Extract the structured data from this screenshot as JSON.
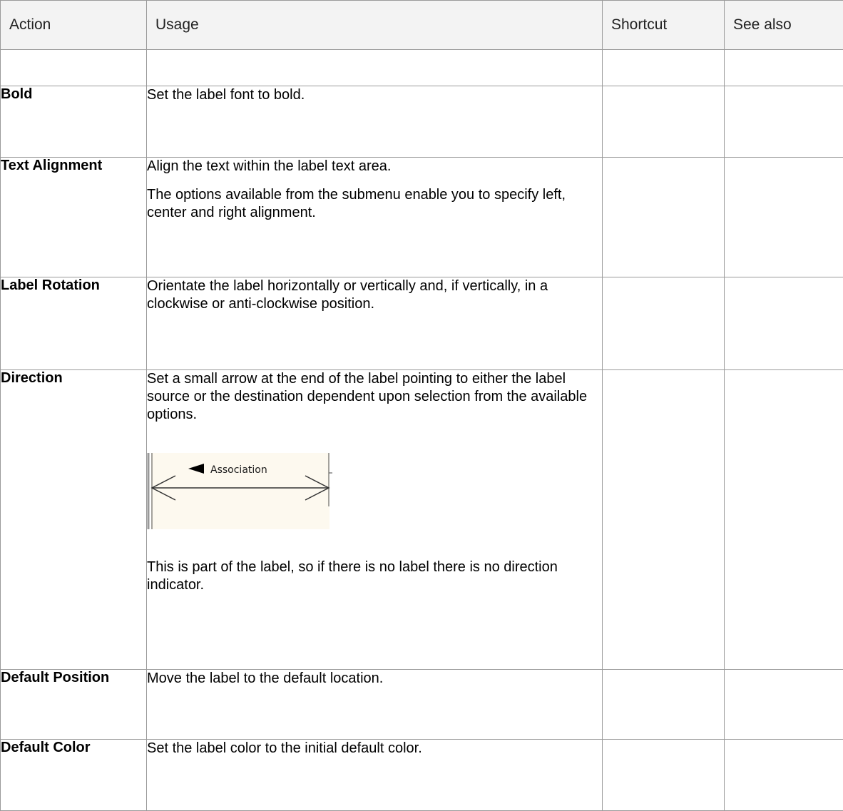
{
  "headers": {
    "action": "Action",
    "usage": "Usage",
    "shortcut": "Shortcut",
    "see_also": "See also"
  },
  "rows": [
    {
      "action": "",
      "usage": [],
      "shortcut": "",
      "see_also": ""
    },
    {
      "action": "Bold",
      "usage": [
        "Set the label font to bold."
      ],
      "shortcut": "",
      "see_also": ""
    },
    {
      "action": "Text Alignment",
      "usage": [
        "Align the text within the label text area.",
        "The options available from the submenu enable you to specify left, center and right alignment."
      ],
      "shortcut": "",
      "see_also": ""
    },
    {
      "action": "Label Rotation",
      "usage": [
        "Orientate the label horizontally or vertically and, if vertically, in a clockwise or anti-clockwise position."
      ],
      "shortcut": "",
      "see_also": ""
    },
    {
      "action": "Direction",
      "usage": [
        "Set a small arrow at the end of the label pointing to either the label source or the destination dependent upon selection from the available options."
      ],
      "usage_after": [
        "This is part of the label, so if there is no label there is no direction indicator."
      ],
      "shortcut": "",
      "see_also": ""
    },
    {
      "action": "Default Position",
      "usage": [
        "Move the label to the default location."
      ],
      "shortcut": "",
      "see_also": ""
    },
    {
      "action": "Default Color",
      "usage": [
        "Set the label color to the initial default color."
      ],
      "shortcut": "",
      "see_also": ""
    }
  ],
  "figure": {
    "label": "Association",
    "icon": "left-pointing-triangle-icon",
    "background": "#fdf9ef"
  }
}
